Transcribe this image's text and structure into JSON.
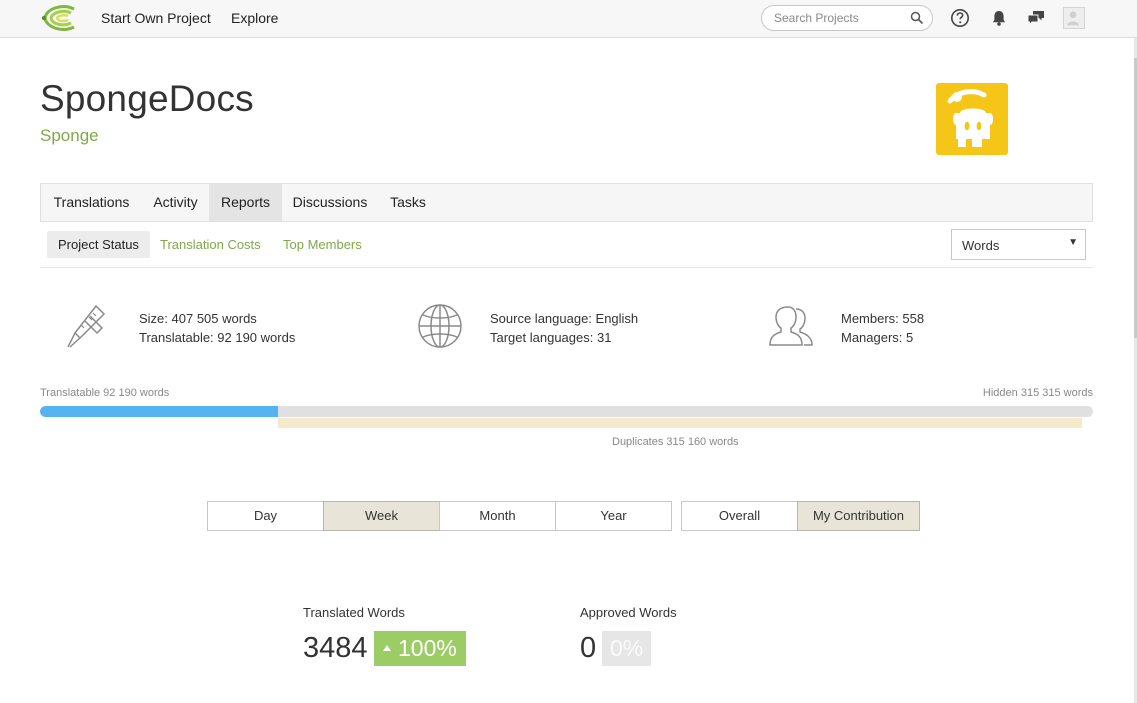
{
  "navbar": {
    "start_project": "Start Own Project",
    "explore": "Explore",
    "search_placeholder": "Search Projects"
  },
  "project": {
    "title": "SpongeDocs",
    "owner": "Sponge"
  },
  "main_tabs": [
    {
      "label": "Translations"
    },
    {
      "label": "Activity"
    },
    {
      "label": "Reports",
      "active": true
    },
    {
      "label": "Discussions"
    },
    {
      "label": "Tasks"
    }
  ],
  "sub_tabs": [
    {
      "label": "Project Status",
      "active": true
    },
    {
      "label": "Translation Costs"
    },
    {
      "label": "Top Members"
    }
  ],
  "units_select": {
    "value": "Words"
  },
  "stats": {
    "size": "Size: 407 505 words",
    "translatable": "Translatable: 92 190 words",
    "source_language": "Source language: English",
    "target_languages": "Target languages: 31",
    "members": "Members: 558",
    "managers": "Managers: 5"
  },
  "progress": {
    "translatable_label": "Translatable 92 190 words",
    "hidden_label": "Hidden 315 315 words",
    "duplicates_label": "Duplicates 315 160 words",
    "translatable_fraction": 0.2262
  },
  "period_buttons": [
    {
      "label": "Day"
    },
    {
      "label": "Week",
      "active": true
    },
    {
      "label": "Month"
    },
    {
      "label": "Year"
    }
  ],
  "scope_buttons": [
    {
      "label": "Overall"
    },
    {
      "label": "My Contribution",
      "active": true
    }
  ],
  "metrics": {
    "translated": {
      "label": "Translated Words",
      "value": "3484",
      "change": "100%"
    },
    "approved": {
      "label": "Approved Words",
      "value": "0",
      "change": "0%"
    }
  },
  "colors": {
    "accent_green": "#7fa84a",
    "progress_blue": "#56b3f1",
    "badge_green": "#9ccc65",
    "logo_yellow": "#f5c518"
  }
}
